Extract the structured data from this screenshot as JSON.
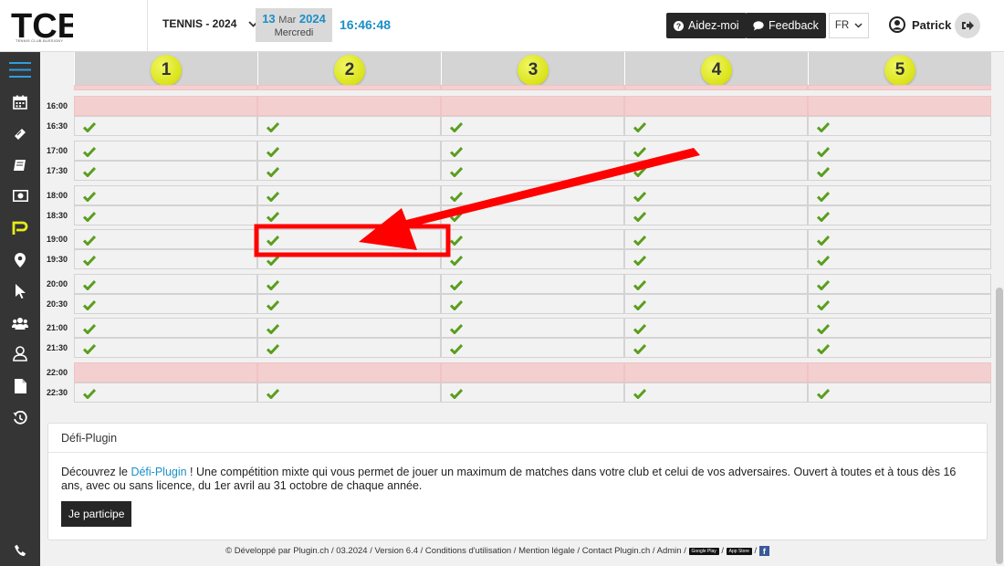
{
  "header": {
    "logo_text": "TCB",
    "logo_subtext": "TENNIS CLUB BUSSIGNY",
    "season": "TENNIS - 2024",
    "date": {
      "day": "13",
      "month": "Mar",
      "year": "2024",
      "weekday": "Mercredi"
    },
    "clock": "16:46:48",
    "help_label": "Aidez-moi",
    "feedback_label": "Feedback",
    "language": "FR",
    "user_name": "Patrick"
  },
  "sidebar": {
    "icons": [
      "menu-icon",
      "calendar-icon",
      "ticket-icon",
      "book-icon",
      "money-icon",
      "plugin-logo-icon",
      "map-pin-icon",
      "cursor-icon",
      "group-icon",
      "user-icon",
      "document-icon",
      "history-icon",
      "phone-icon"
    ]
  },
  "courts": [
    "1",
    "2",
    "3",
    "4",
    "5"
  ],
  "schedule": [
    {
      "time": "16:00",
      "closed": true,
      "slots": [
        false,
        false,
        false,
        false,
        false
      ]
    },
    {
      "time": "16:30",
      "closed": false,
      "slots": [
        true,
        true,
        true,
        true,
        true
      ]
    },
    {
      "time": "17:00",
      "closed": false,
      "slots": [
        true,
        true,
        true,
        true,
        true
      ]
    },
    {
      "time": "17:30",
      "closed": false,
      "slots": [
        true,
        true,
        true,
        true,
        true
      ]
    },
    {
      "time": "18:00",
      "closed": false,
      "slots": [
        true,
        true,
        true,
        true,
        true
      ]
    },
    {
      "time": "18:30",
      "closed": false,
      "slots": [
        true,
        true,
        true,
        true,
        true
      ]
    },
    {
      "time": "19:00",
      "closed": false,
      "slots": [
        true,
        true,
        true,
        true,
        true
      ]
    },
    {
      "time": "19:30",
      "closed": false,
      "slots": [
        true,
        true,
        true,
        true,
        true
      ]
    },
    {
      "time": "20:00",
      "closed": false,
      "slots": [
        true,
        true,
        true,
        true,
        true
      ]
    },
    {
      "time": "20:30",
      "closed": false,
      "slots": [
        true,
        true,
        true,
        true,
        true
      ]
    },
    {
      "time": "21:00",
      "closed": false,
      "slots": [
        true,
        true,
        true,
        true,
        true
      ]
    },
    {
      "time": "21:30",
      "closed": false,
      "slots": [
        true,
        true,
        true,
        true,
        true
      ]
    },
    {
      "time": "22:00",
      "closed": true,
      "slots": [
        false,
        false,
        false,
        false,
        false
      ]
    },
    {
      "time": "22:30",
      "closed": false,
      "slots": [
        true,
        true,
        true,
        true,
        true
      ]
    }
  ],
  "colors": {
    "accent": "#1b8fc7",
    "available_check": "#5a9e1f",
    "closed_slot": "#f3cfd0",
    "sidebar": "#353535",
    "annotation": "#ff0000"
  },
  "defi_card": {
    "title": "Défi-Plugin",
    "text_before_link": "Découvrez le ",
    "link_text": "Défi-Plugin",
    "text_after_link": " ! Une compétition mixte qui vous permet de jouer un maximum de matches dans votre club et celui de vos adversaires. Ouvert à toutes et à tous dès 16 ans, avec ou sans licence, du 1er avril au 31 octobre de chaque année.",
    "button_label": "Je participe"
  },
  "footer": {
    "text": "© Développé par Plugin.ch / 03.2024 / Version 6.4 / Conditions d'utilisation / Mention légale / Contact Plugin.ch / Admin /",
    "google_play": "Google Play",
    "app_store": "App Store",
    "facebook": "f"
  }
}
